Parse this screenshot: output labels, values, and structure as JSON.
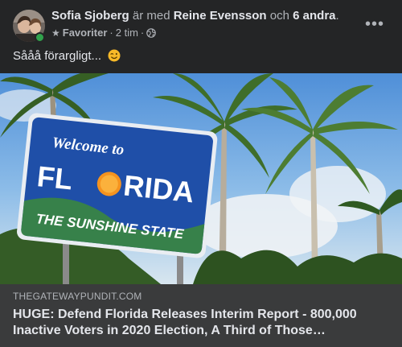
{
  "post": {
    "author": "Sofia Sjoberg",
    "with_word": "är med",
    "tagged": "Reine Evensson",
    "and_word": "och",
    "others": "6 andra",
    "period": ".",
    "audience_label": "Favoriter",
    "separator": "·",
    "time": "2 tim",
    "more_label": "•••",
    "text": "Sååå förargligt...",
    "emoji": "winking-face-emoji"
  },
  "link": {
    "domain": "THEGATEWAYPUNDIT.COM",
    "title": "HUGE: Defend Florida Releases Interim Report - 800,000 Inactive Voters in 2020 Election, A Third of Those…"
  },
  "sign": {
    "welcome": "Welcome to",
    "state_left": "FL",
    "state_right": "RIDA",
    "tagline": "THE SUNSHINE STATE"
  },
  "colors": {
    "background": "#242526",
    "footer": "#3a3b3c",
    "sign_blue": "#1f4fa8",
    "online": "#31a24c"
  }
}
